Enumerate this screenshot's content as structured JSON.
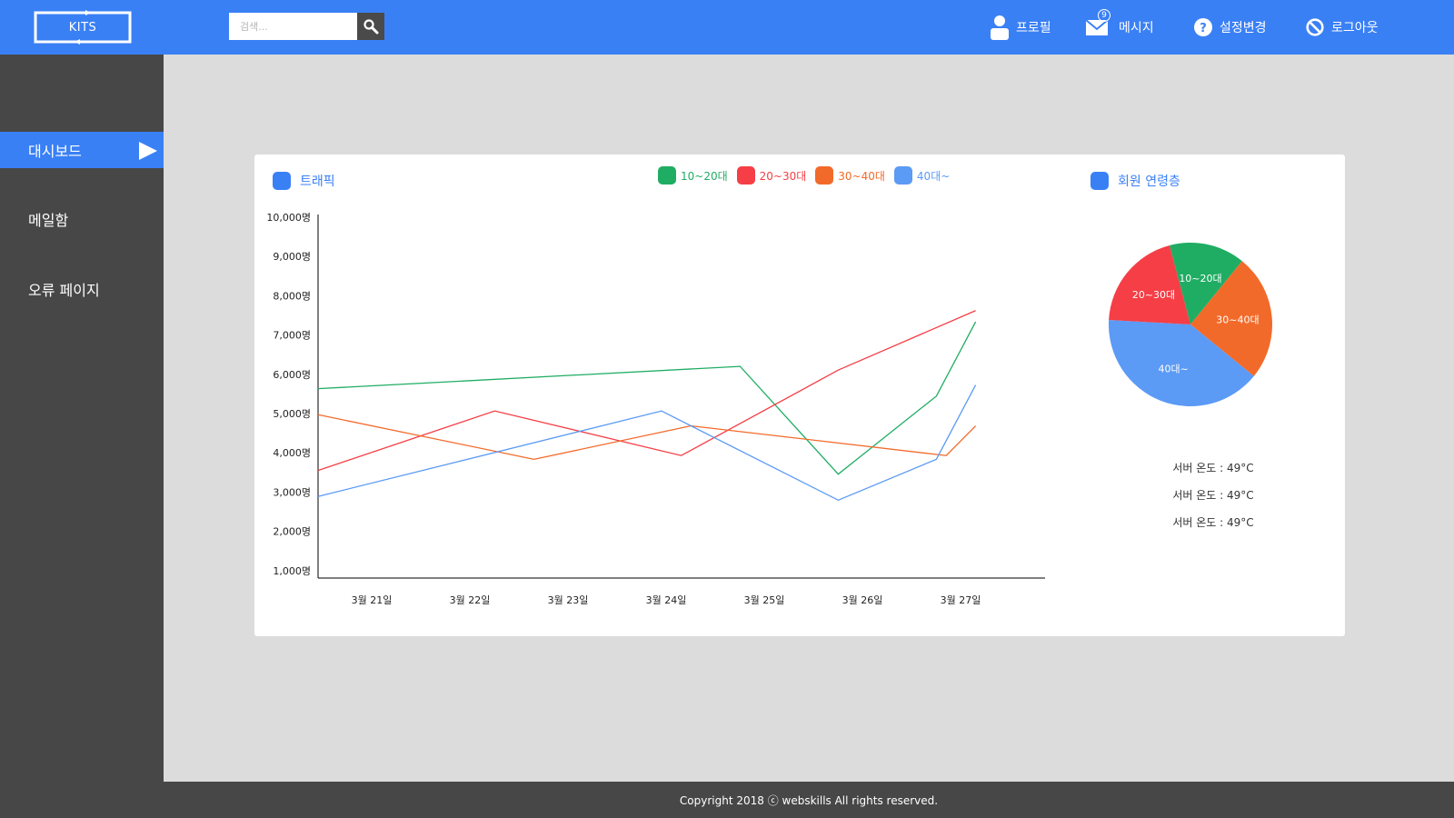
{
  "header": {
    "logo_text": "KITS",
    "search_placeholder": "검색...",
    "nav": [
      {
        "label": "프로필",
        "icon": "user-icon"
      },
      {
        "label": "메시지",
        "icon": "mail-icon",
        "badge": "9"
      },
      {
        "label": "설정변경",
        "icon": "help-icon"
      },
      {
        "label": "로그아웃",
        "icon": "block-icon"
      }
    ]
  },
  "sidebar": {
    "items": [
      {
        "label": "대시보드",
        "active": true
      },
      {
        "label": "메일함",
        "active": false
      },
      {
        "label": "오류 페이지",
        "active": false
      }
    ]
  },
  "card": {
    "traffic_title": "트래픽",
    "members_title": "회원 연령층",
    "server_temps": [
      "서버 온도 : 49°C",
      "서버 온도 : 49°C",
      "서버 온도 : 49°C"
    ]
  },
  "footer": {
    "text": "Copyright 2018 ⓒ webskills All rights reserved."
  },
  "colors": {
    "accent": "#3a80f5",
    "series_10_20": "#1fad63",
    "series_20_30": "#f53e46",
    "series_30_40": "#f26a2a",
    "series_40": "#5b9af5"
  },
  "chart_data": [
    {
      "type": "line",
      "title": "트래픽",
      "x": [
        "3월 21일",
        "",
        "3월 22일",
        "3월 23일",
        "3월 24일",
        "3월 25일",
        "3월 26일",
        "3월 27일",
        ""
      ],
      "x_tick_labels": [
        "3월 21일",
        "3월 22일",
        "3월 23일",
        "3월 24일",
        "3월 25일",
        "3월 26일",
        "3월 27일"
      ],
      "y_tick_labels": [
        "10,000명",
        "9,000명",
        "8,000명",
        "7,000명",
        "6,000명",
        "5,000명",
        "4,000명",
        "3,000명",
        "2,000명",
        "1,000명"
      ],
      "ylim": [
        1000,
        10000
      ],
      "series": [
        {
          "name": "10~20대",
          "color": "#1fad63",
          "points": [
            [
              0,
              5900
            ],
            [
              4.3,
              6500
            ],
            [
              5.3,
              3600
            ],
            [
              6.3,
              5700
            ],
            [
              6.7,
              7700
            ]
          ]
        },
        {
          "name": "20~30대",
          "color": "#f53e46",
          "points": [
            [
              0,
              3700
            ],
            [
              1.8,
              5300
            ],
            [
              3.7,
              4100
            ],
            [
              5.3,
              6400
            ],
            [
              6.7,
              8000
            ]
          ]
        },
        {
          "name": "30~40대",
          "color": "#f26a2a",
          "points": [
            [
              0,
              5200
            ],
            [
              2.2,
              4000
            ],
            [
              3.8,
              4900
            ],
            [
              6.4,
              4100
            ],
            [
              6.7,
              4900
            ]
          ]
        },
        {
          "name": "40대~",
          "color": "#5b9af5",
          "points": [
            [
              0,
              3000
            ],
            [
              3.5,
              5300
            ],
            [
              5.3,
              2900
            ],
            [
              6.3,
              4000
            ],
            [
              6.7,
              6000
            ]
          ]
        }
      ],
      "legend_position": "top-center",
      "grid": false
    },
    {
      "type": "pie",
      "title": "회원 연령층",
      "slices": [
        {
          "label": "10~20대",
          "value": 15,
          "color": "#1fad63"
        },
        {
          "label": "30~40대",
          "value": 25,
          "color": "#f26a2a"
        },
        {
          "label": "40대~",
          "value": 40,
          "color": "#5b9af5"
        },
        {
          "label": "20~30대",
          "value": 20,
          "color": "#f53e46"
        }
      ]
    }
  ]
}
